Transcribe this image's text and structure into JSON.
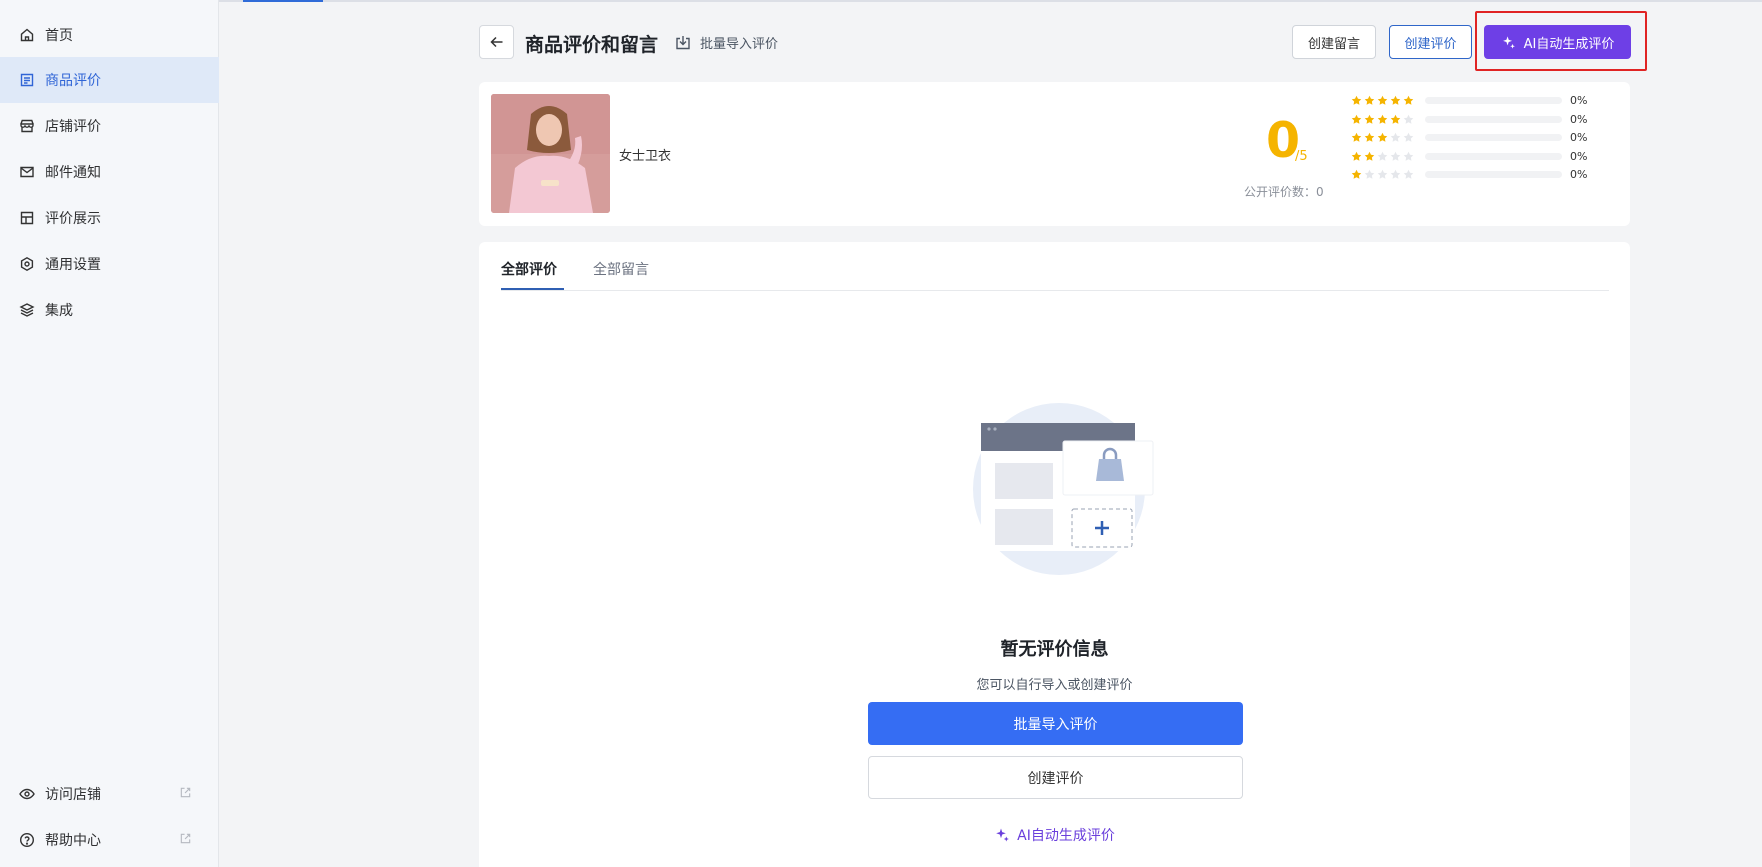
{
  "sidebar": {
    "items": [
      {
        "label": "首页",
        "icon": "home-icon"
      },
      {
        "label": "商品评价",
        "icon": "product-review-icon",
        "active": true
      },
      {
        "label": "店铺评价",
        "icon": "store-icon"
      },
      {
        "label": "邮件通知",
        "icon": "mail-icon"
      },
      {
        "label": "评价展示",
        "icon": "layout-icon"
      },
      {
        "label": "通用设置",
        "icon": "settings-icon"
      },
      {
        "label": "集成",
        "icon": "layers-icon"
      }
    ],
    "bottom": [
      {
        "label": "访问店铺",
        "icon": "eye-icon"
      },
      {
        "label": "帮助中心",
        "icon": "help-icon"
      }
    ]
  },
  "header": {
    "title": "商品评价和留言",
    "import_label": "批量导入评价",
    "create_message_label": "创建留言",
    "create_review_label": "创建评价",
    "ai_generate_label": "AI自动生成评价"
  },
  "product": {
    "name": "女士卫衣",
    "score": "0",
    "score_max": "/5",
    "public_count_label": "公开评价数：0",
    "distribution": [
      {
        "stars": 5,
        "percent": 0,
        "label": "0%"
      },
      {
        "stars": 4,
        "percent": 0,
        "label": "0%"
      },
      {
        "stars": 3,
        "percent": 0,
        "label": "0%"
      },
      {
        "stars": 2,
        "percent": 0,
        "label": "0%"
      },
      {
        "stars": 1,
        "percent": 0,
        "label": "0%"
      }
    ]
  },
  "reviews": {
    "tabs": [
      {
        "label": "全部评价",
        "active": true
      },
      {
        "label": "全部留言",
        "active": false
      }
    ],
    "empty": {
      "title": "暂无评价信息",
      "subtitle": "您可以自行导入或创建评价",
      "primary_label": "批量导入评价",
      "secondary_label": "创建评价",
      "ai_label": "AI自动生成评价"
    }
  },
  "colors": {
    "accent": "#356df3",
    "ai_purple": "#6e3fe6",
    "star": "#f5b400",
    "highlight": "#e02424"
  }
}
